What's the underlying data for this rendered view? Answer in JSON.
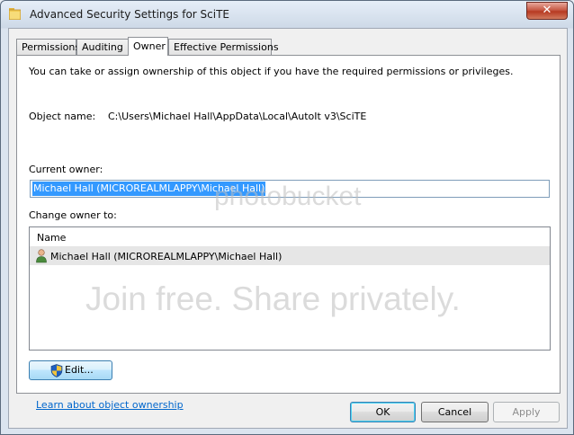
{
  "window": {
    "title": "Advanced Security Settings for SciTE",
    "close_glyph": "✕"
  },
  "tabs": [
    {
      "label": "Permissions"
    },
    {
      "label": "Auditing"
    },
    {
      "label": "Owner",
      "active": true
    },
    {
      "label": "Effective Permissions"
    }
  ],
  "owner_tab": {
    "intro": "You can take or assign ownership of this object if you have the required permissions or privileges.",
    "object_name_label": "Object name:",
    "object_name_value": "C:\\Users\\Michael Hall\\AppData\\Local\\AutoIt v3\\SciTE",
    "current_owner_label": "Current owner:",
    "current_owner_value": "Michael Hall (MICROREALMLAPPY\\Michael Hall)",
    "change_owner_label": "Change owner to:",
    "list": {
      "column_header": "Name",
      "rows": [
        {
          "name": "Michael Hall (MICROREALMLAPPY\\Michael Hall)",
          "icon": "user-icon"
        }
      ]
    },
    "edit_button": "Edit...",
    "learn_link": "Learn about object ownership"
  },
  "watermark": {
    "brand": "photobucket",
    "tagline": "Join free. Share privately."
  },
  "buttons": {
    "ok": "OK",
    "cancel": "Cancel",
    "apply": "Apply"
  }
}
